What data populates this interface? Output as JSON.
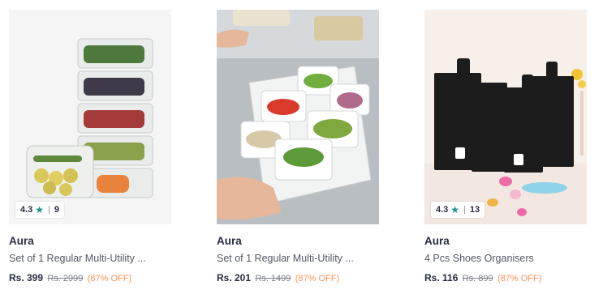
{
  "products": [
    {
      "rating": "4.3",
      "rating_count": "9",
      "brand": "Aura",
      "title": "Set of 1 Regular Multi-Utility ...",
      "price": "Rs. 399",
      "mrp": "Rs. 2999",
      "discount": "(87% OFF)"
    },
    {
      "brand": "Aura",
      "title": "Set of 1 Regular Multi-Utility ...",
      "price": "Rs. 201",
      "mrp": "Rs. 1499",
      "discount": "(87% OFF)"
    },
    {
      "rating": "4.3",
      "rating_count": "13",
      "brand": "Aura",
      "title": "4 Pcs Shoes Organisers",
      "price": "Rs. 116",
      "mrp": "Rs. 899",
      "discount": "(87% OFF)"
    }
  ],
  "icons": {
    "rating": "star-icon"
  },
  "colors": {
    "rating_star": "#14958f",
    "discount": "#ff905a",
    "text_dark": "#282c3f"
  }
}
